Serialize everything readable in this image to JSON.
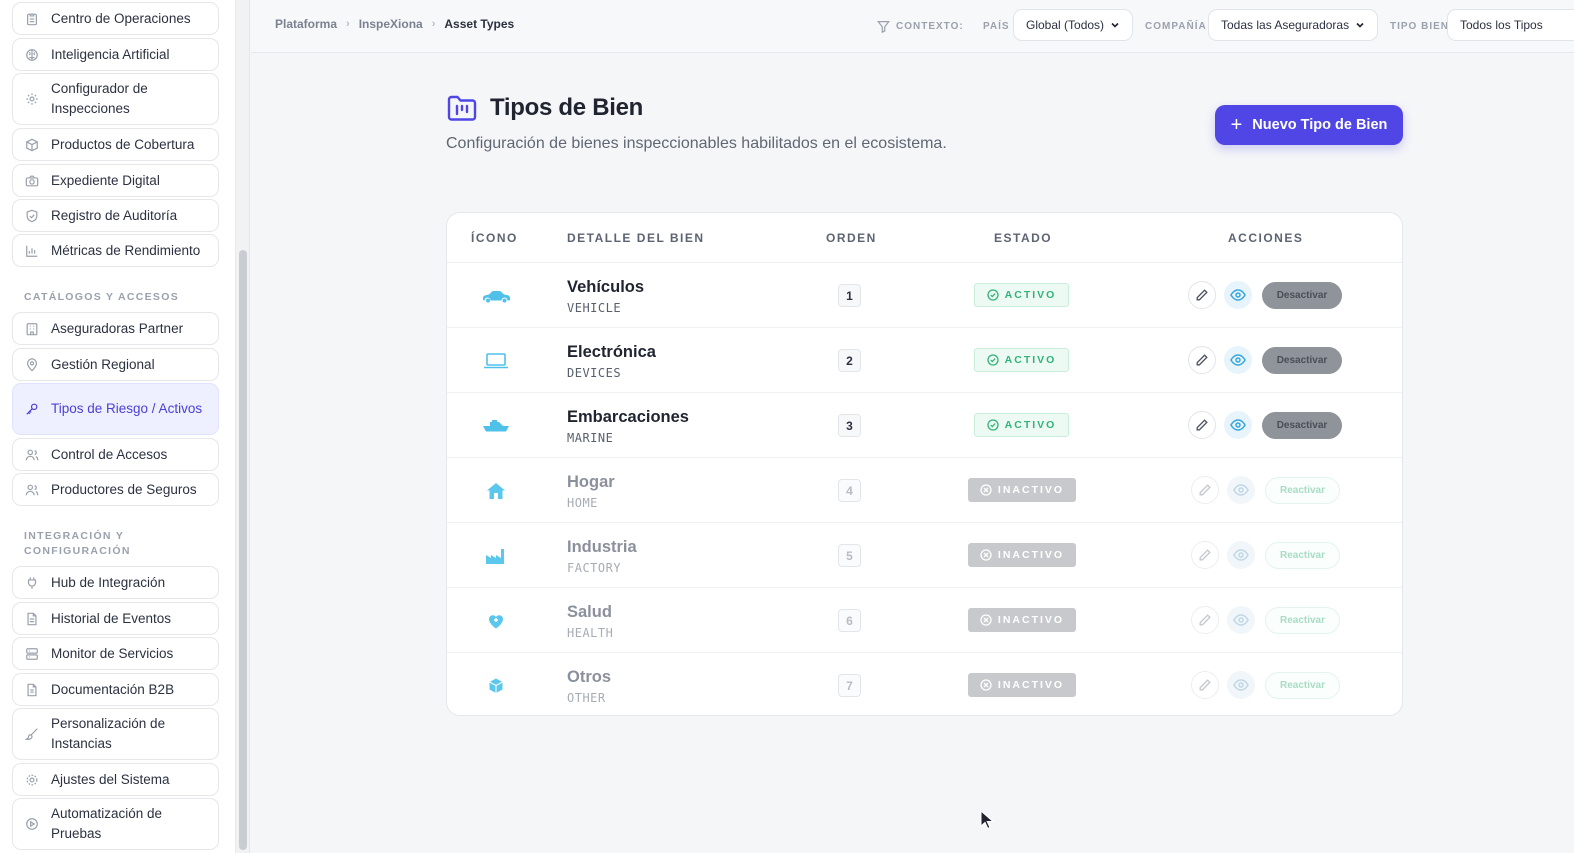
{
  "sidebar": {
    "items_top": [
      {
        "label": "Centro de Operaciones",
        "icon": "clipboard-icon"
      },
      {
        "label": "Inteligencia Artificial",
        "icon": "brain-icon"
      },
      {
        "label": "Configurador de Inspecciones",
        "icon": "settings-icon"
      },
      {
        "label": "Productos de Cobertura",
        "icon": "box-icon"
      },
      {
        "label": "Expediente Digital",
        "icon": "camera-icon"
      },
      {
        "label": "Registro de Auditoría",
        "icon": "shield-icon"
      },
      {
        "label": "Métricas de Rendimiento",
        "icon": "bar-chart-icon"
      }
    ],
    "section_catalogos": "CATÁLOGOS Y ACCESOS",
    "items_catalogos": [
      {
        "label": "Aseguradoras Partner",
        "icon": "building-icon"
      },
      {
        "label": "Gestión Regional",
        "icon": "map-pin-icon"
      },
      {
        "label": "Tipos de Riesgo / Activos",
        "icon": "key-icon"
      },
      {
        "label": "Control de Accesos",
        "icon": "users-icon"
      },
      {
        "label": "Productores de Seguros",
        "icon": "users-icon"
      }
    ],
    "section_integracion": "INTEGRACIÓN Y CONFIGURACIÓN",
    "items_integracion": [
      {
        "label": "Hub de Integración",
        "icon": "plug-icon"
      },
      {
        "label": "Historial de Eventos",
        "icon": "file-icon"
      },
      {
        "label": "Monitor de Servicios",
        "icon": "server-icon"
      },
      {
        "label": "Documentación B2B",
        "icon": "document-icon"
      },
      {
        "label": "Personalización de Instancias",
        "icon": "brush-icon"
      },
      {
        "label": "Ajustes del Sistema",
        "icon": "gear-icon"
      },
      {
        "label": "Automatización de Pruebas",
        "icon": "play-circle-icon"
      }
    ]
  },
  "header": {
    "breadcrumb": [
      "Plataforma",
      "InspeXiona",
      "Asset Types"
    ],
    "context_label": "CONTEXTO:",
    "filters": [
      {
        "label": "PAÍS",
        "value": "Global (Todos)"
      },
      {
        "label": "COMPAÑÍA",
        "value": "Todas las Aseguradoras"
      },
      {
        "label": "TIPO BIEN",
        "value": "Todos los Tipos"
      }
    ]
  },
  "main": {
    "title": "Tipos de Bien",
    "subtitle": "Configuración de bienes inspeccionables habilitados en el ecosistema.",
    "new_button": "Nuevo Tipo de Bien",
    "columns": [
      "ÍCONO",
      "DETALLE DEL BIEN",
      "ORDEN",
      "ESTADO",
      "ACCIONES"
    ],
    "rows": [
      {
        "name": "Vehículos",
        "code": "VEHICLE",
        "order": "1",
        "status": "ACTIVO",
        "action": "Desactivar",
        "icon": "car-icon",
        "active": true
      },
      {
        "name": "Electrónica",
        "code": "DEVICES",
        "order": "2",
        "status": "ACTIVO",
        "action": "Desactivar",
        "icon": "laptop-icon",
        "active": true
      },
      {
        "name": "Embarcaciones",
        "code": "MARINE",
        "order": "3",
        "status": "ACTIVO",
        "action": "Desactivar",
        "icon": "ship-icon",
        "active": true
      },
      {
        "name": "Hogar",
        "code": "HOME",
        "order": "4",
        "status": "INACTIVO",
        "action": "Reactivar",
        "icon": "home-icon",
        "active": false
      },
      {
        "name": "Industria",
        "code": "FACTORY",
        "order": "5",
        "status": "INACTIVO",
        "action": "Reactivar",
        "icon": "factory-icon",
        "active": false
      },
      {
        "name": "Salud",
        "code": "HEALTH",
        "order": "6",
        "status": "INACTIVO",
        "action": "Reactivar",
        "icon": "heart-icon",
        "active": false
      },
      {
        "name": "Otros",
        "code": "OTHER",
        "order": "7",
        "status": "INACTIVO",
        "action": "Reactivar",
        "icon": "cube-icon",
        "active": false
      }
    ]
  },
  "colors": {
    "accent": "#4f46e5",
    "active_green": "#34b27a",
    "icon_blue": "#4fc1e9"
  }
}
